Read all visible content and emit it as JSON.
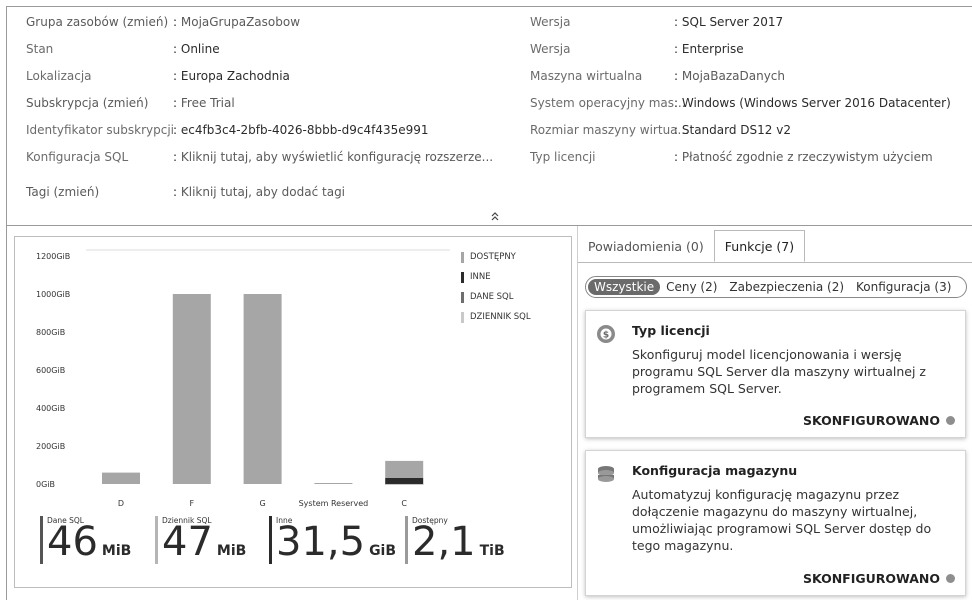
{
  "essentials": {
    "left": [
      {
        "label": "Grupa zasobów (zmień)",
        "value": "MojaGrupaZasobow"
      },
      {
        "label": "Stan",
        "value": "Online"
      },
      {
        "label": "Lokalizacja",
        "value": "Europa Zachodnia"
      },
      {
        "label": "Subskrypcja (zmień)",
        "value": "Free Trial"
      },
      {
        "label": "Identyfikator subskrypcji",
        "value": "ec4fb3c4-2bfb-4026-8bbb-d9c4f435e991"
      },
      {
        "label": "Konfiguracja SQL",
        "value": "Kliknij tutaj, aby wyświetlić konfigurację rozszerze..."
      },
      {
        "label": "Tagi (zmień)",
        "value": "Kliknij tutaj, aby dodać tagi"
      }
    ],
    "right": [
      {
        "label": "Wersja",
        "value": "SQL Server 2017"
      },
      {
        "label": "Wersja",
        "value": "Enterprise"
      },
      {
        "label": "Maszyna wirtualna",
        "value": "MojaBazaDanych"
      },
      {
        "label": "System operacyjny mas...",
        "value": "Windows (Windows Server 2016 Datacenter)"
      },
      {
        "label": "Rozmiar maszyny wirtua...",
        "value": "Standard DS12 v2"
      },
      {
        "label": "Typ licencji",
        "value": "Płatność zgodnie z rzeczywistym użyciem"
      }
    ],
    "separator": ":",
    "collapse_icon": "chevron-double-up-icon"
  },
  "chart_data": {
    "type": "bar",
    "stacked": true,
    "categories": [
      "D",
      "F",
      "G",
      "System Reserved",
      "C"
    ],
    "series": [
      {
        "name": "DOSTĘPNY",
        "values": [
          60,
          1000,
          1000,
          0,
          90
        ],
        "color": "#a6a6a6"
      },
      {
        "name": "INNE",
        "values": [
          0,
          0,
          0,
          0,
          31.5
        ],
        "color": "#2b2b2b"
      },
      {
        "name": "DANE SQL",
        "values": [
          0,
          0,
          0,
          0,
          0.05
        ],
        "color": "#6e6e6e"
      },
      {
        "name": "DZIENNIK SQL",
        "values": [
          0,
          0,
          0,
          0,
          0.05
        ],
        "color": "#c9c9c9"
      }
    ],
    "yticks": [
      "1200GiB",
      "1000GiB",
      "800GiB",
      "600GiB",
      "400GiB",
      "200GiB",
      "0GiB"
    ],
    "ylim": [
      0,
      1200
    ],
    "legend": "top-right",
    "grid": false
  },
  "stats": [
    {
      "label": "Dane SQL",
      "value": "46",
      "unit": "MiB",
      "color": "#555555"
    },
    {
      "label": "Dziennik SQL",
      "value": "47",
      "unit": "MiB",
      "color": "#b5b5b5"
    },
    {
      "label": "Inne",
      "value": "31,5",
      "unit": "GiB",
      "color": "#2b2b2b"
    },
    {
      "label": "Dostępny",
      "value": "2,1",
      "unit": "TiB",
      "color": "#9a9a9a"
    }
  ],
  "tabs": [
    {
      "label": "Powiadomienia (0)",
      "active": false
    },
    {
      "label": "Funkcje (7)",
      "active": true
    }
  ],
  "filters": [
    {
      "label": "Wszystkie",
      "active": true
    },
    {
      "label": "Ceny (2)",
      "active": false
    },
    {
      "label": "Zabezpieczenia (2)",
      "active": false
    },
    {
      "label": "Konfiguracja (3)",
      "active": false
    }
  ],
  "features": [
    {
      "title": "Typ licencji",
      "icon": "license-icon",
      "description": "Skonfiguruj model licencjonowania i wersję programu SQL Server dla maszyny wirtualnej z programem SQL Server.",
      "status": "SKONFIGUROWANO"
    },
    {
      "title": "Konfiguracja magazynu",
      "icon": "storage-icon",
      "description": "Automatyzuj konfigurację magazynu przez dołączenie magazynu do maszyny wirtualnej, umożliwiając programowi SQL Server dostęp do tego magazynu.",
      "status": "SKONFIGUROWANO"
    }
  ]
}
